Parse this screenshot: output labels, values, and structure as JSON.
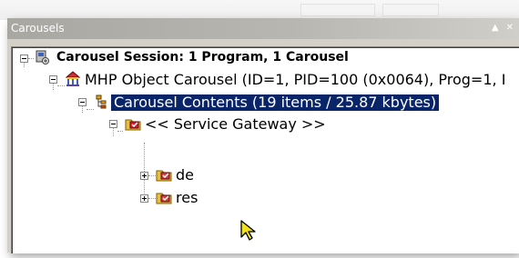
{
  "window": {
    "title": "Carousels",
    "scroll_up_glyph": "▲",
    "close_glyph": "✕"
  },
  "tree": {
    "session": "Carousel Session: 1 Program, 1 Carousel",
    "carousel": "MHP Object Carousel (ID=1, PID=100 (0x0064), Prog=1, I",
    "contents": "Carousel Contents (19 items / 25.87 kbytes)",
    "gateway": "<< Service Gateway >>",
    "folders": [
      "de",
      "res"
    ]
  },
  "icons": {
    "session": "session-icon",
    "carousel": "carousel-icon",
    "contents": "contents-icon",
    "gateway": "gateway-folder-icon",
    "folder": "folder-icon",
    "cursor": "mouse-pointer-icon"
  },
  "colors": {
    "selection": "#0a246a",
    "titlebar": "#aaa8a3",
    "panel": "#d4d0c8"
  }
}
